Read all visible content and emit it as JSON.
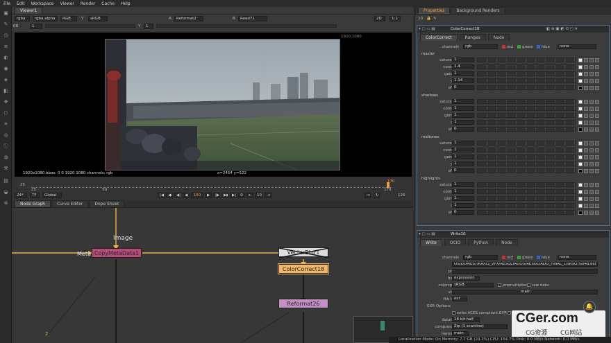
{
  "menubar": {
    "items": [
      "File",
      "Edit",
      "Workspace",
      "Viewer",
      "Render",
      "Cache",
      "Help"
    ]
  },
  "viewer": {
    "tab": "Viewer1",
    "layer": "rgba",
    "channel": "rgba.alpha",
    "display": "RGB",
    "y_label": "Y",
    "colorspace": "sRGB",
    "a_label": "A",
    "a_input": "Reformat2",
    "b_label": "B",
    "b_input": "Read71",
    "mode": "2D",
    "zoom": "1:1",
    "fstop": "f/8",
    "frame_value": "1",
    "gain_value": "1",
    "y_value": "Y",
    "res_tag": "1920,1080",
    "info_left": "1920x1080  bbox: 0 0 1920 1080 channels: rgb",
    "info_right": "x=2454 y=522"
  },
  "timeline": {
    "ticks": [
      "25",
      "50",
      "75",
      "100",
      "125",
      "150"
    ],
    "end_top": "170",
    "end_bottom": "170",
    "fps": "24*",
    "tf": "TF",
    "scope": "Global",
    "current": "150",
    "step": "10",
    "count": "126",
    "zero": "0"
  },
  "nodegraph": {
    "tabs": [
      "Node Graph",
      "Curve Editor",
      "Dope Sheet"
    ],
    "nodes": {
      "copy": "CopyMetaData1",
      "vector": "VectorBlur1",
      "cc": "ColorCorrect18",
      "reformat": "Reformat26"
    },
    "labels": {
      "image": "Image",
      "meta": "Meta"
    },
    "small_label": "2"
  },
  "properties": {
    "tabs": [
      "Properties",
      "Background Renders"
    ],
    "count": "10",
    "cc": {
      "name": "ColorCorrect18",
      "tabs": [
        "ColorCorrect",
        "Ranges",
        "Node"
      ],
      "channels_label": "channels",
      "channels": "rgb",
      "red": "red",
      "green": "green",
      "blue": "blue",
      "none": "none",
      "sections": [
        {
          "title": "master",
          "rows": [
            [
              "saturation",
              "1"
            ],
            [
              "contrast",
              "1.4"
            ],
            [
              "gamma",
              "1"
            ],
            [
              "gain",
              "1.14"
            ],
            [
              "offset",
              "0"
            ]
          ]
        },
        {
          "title": "shadows",
          "rows": [
            [
              "saturation",
              "1"
            ],
            [
              "contrast",
              "1"
            ],
            [
              "gamma",
              "1"
            ],
            [
              "gain",
              "1"
            ],
            [
              "offset",
              "0"
            ]
          ]
        },
        {
          "title": "midtones",
          "rows": [
            [
              "saturation",
              "1"
            ],
            [
              "contrast",
              "1"
            ],
            [
              "gamma",
              "1"
            ],
            [
              "gain",
              "1"
            ],
            [
              "offset",
              "0"
            ]
          ]
        },
        {
          "title": "highlights",
          "rows": [
            [
              "saturation",
              "1"
            ],
            [
              "contrast",
              "1"
            ],
            [
              "gamma",
              "1"
            ],
            [
              "gain",
              "1"
            ],
            [
              "offset",
              "0"
            ]
          ]
        }
      ]
    },
    "write": {
      "name": "Write10",
      "tabs": [
        "Write",
        "OCIO",
        "Python",
        "Node"
      ],
      "channels_label": "channels",
      "channels": "rgb",
      "red": "red",
      "green": "green",
      "blue": "blue",
      "none": "none",
      "file_label": "file",
      "file": "OS/DOMESTIKA/03_VFX/RESULTADOS/RESULTADO_FINAL_CURSO.%04d.exr",
      "proxy_label": "proxy",
      "frame_label": "frame",
      "frame": "expression",
      "colorspace_label": "colorspace",
      "colorspace": "sRGB",
      "premultiplied": "premultiplied",
      "raw": "raw data",
      "views_label": "views",
      "views": "main",
      "filetype_label": "file type",
      "filetype": "exr",
      "exr_options": "EXR Options",
      "aces": "write ACES compliant EXR",
      "autocrop": "autocrop",
      "datatype_label": "datatype",
      "datatype": "16 bit half",
      "compression_label": "compression",
      "compression": "Zip (1 scanline)",
      "heroview_label": "heroview",
      "heroview": "main",
      "metadata_label": "metadata"
    }
  },
  "status": {
    "text": "Localization Mode: On  Memory: 7.7 GB (24.2%)  CPU: 154.7%  Disk: 0.0 MB/s  Network: 0.0 MB/s"
  },
  "watermark": {
    "main": "CGer.com",
    "sub1": "CG资源",
    "sub2": "CG网站"
  }
}
